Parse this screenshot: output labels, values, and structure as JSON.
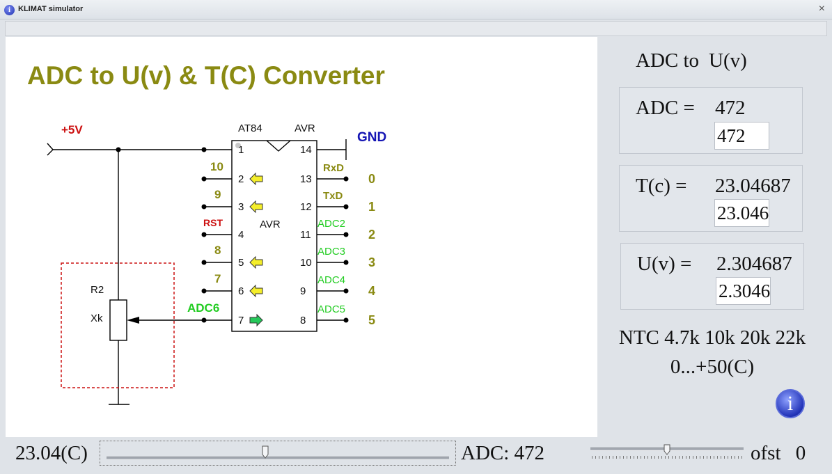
{
  "window": {
    "title": "KLIMAT simulator",
    "close_glyph": "×",
    "icon": "info-icon"
  },
  "diagram": {
    "headline": "ADC to U(v) & T(C) Converter",
    "supply_label": "+5V",
    "ground_label": "GND",
    "chip_name": "AT84",
    "chip_family": "AVR",
    "chip_center_label": "AVR",
    "resistor_name": "R2",
    "resistor_value": "Xk",
    "left_pins": [
      "1",
      "2",
      "3",
      "4",
      "5",
      "6",
      "7"
    ],
    "right_pins": [
      "14",
      "13",
      "12",
      "11",
      "10",
      "9",
      "8"
    ],
    "left_labels": [
      "10",
      "9",
      "RST",
      "8",
      "7",
      "ADC6"
    ],
    "right_signal_labels": [
      "RxD",
      "TxD",
      "ADC2",
      "ADC3",
      "ADC4",
      "ADC5"
    ],
    "right_numbers": [
      "0",
      "1",
      "2",
      "3",
      "4",
      "5"
    ],
    "colors": {
      "olive": "#8a8a12",
      "red": "#cc1111",
      "blue": "#1515b4",
      "green": "#22cc22",
      "yellow_arrow": "#f4ee2a",
      "green_arrow": "#25c95a"
    }
  },
  "panel": {
    "mode_title_left": "ADC to",
    "mode_title_right": "U(v)",
    "adc": {
      "label": "ADC =",
      "value": "472",
      "field": "472"
    },
    "temp": {
      "label": "T(c) =",
      "value": "23.04687",
      "field": "23.046"
    },
    "volt": {
      "label": "U(v) =",
      "value": "2.304687",
      "field": "2.3046"
    },
    "ntc_line1": "NTC 4.7k 10k 20k 22k",
    "ntc_line2": "0...+50(C)",
    "info_glyph": "i",
    "info_icon": "info-icon"
  },
  "bottom": {
    "temp_readout": "23.04(C)",
    "temp_slider_fraction": 0.4608,
    "adc_readout": "ADC: 472",
    "ofst_slider_fraction": 0.5,
    "ofst_label": "ofst",
    "ofst_value": "0"
  }
}
